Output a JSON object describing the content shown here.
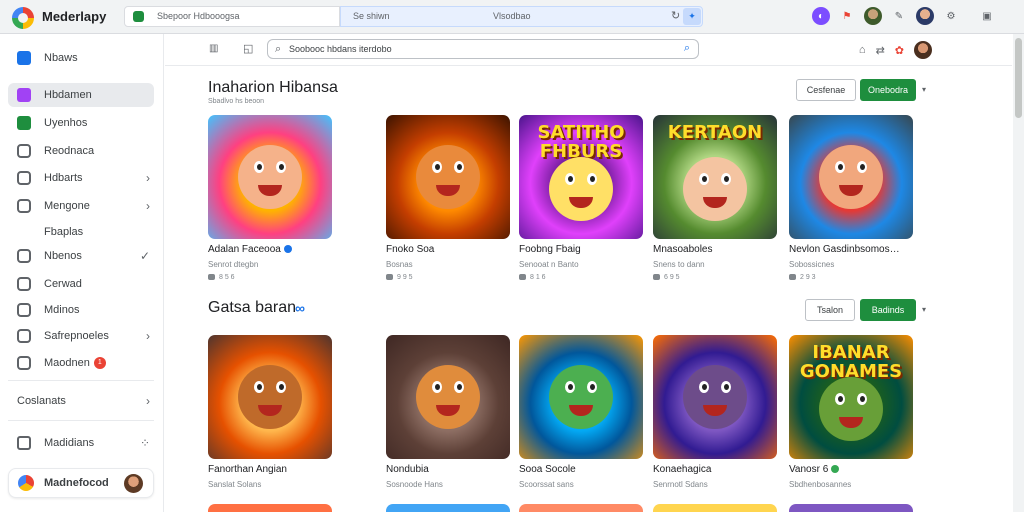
{
  "browser": {
    "brand": "Mederlapy",
    "address_text": "Sbepoor Hdbooogsa",
    "tab_text_left": "Se shiwn",
    "tab_text_right": "Vlsodbao"
  },
  "sidebar": {
    "items": [
      {
        "label": "Nbaws",
        "icon": "home-icon",
        "color": "#1a73e8",
        "active": false,
        "chevron": false
      },
      {
        "label": "Hbdamen",
        "icon": "grid-icon",
        "color": "#a142f4",
        "active": true,
        "chevron": false
      },
      {
        "label": "Uyenhos",
        "icon": "apps-icon",
        "color": "#1e8e3e",
        "active": false,
        "chevron": false
      },
      {
        "label": "Reodnaca",
        "icon": "camera-icon",
        "color": "#5f6368",
        "active": false,
        "chevron": false
      },
      {
        "label": "Hdbarts",
        "icon": "list-icon",
        "color": "#5f6368",
        "active": false,
        "chevron": true
      },
      {
        "label": "Mengone",
        "icon": "play-icon",
        "color": "#5f6368",
        "active": false,
        "chevron": true
      },
      {
        "label": "Fbaplas",
        "icon": "none",
        "color": "transparent",
        "active": false,
        "chevron": false
      },
      {
        "label": "Nbenos",
        "icon": "eye-icon",
        "color": "#5f6368",
        "active": false,
        "chevron": false,
        "chevron_alt": "✓"
      },
      {
        "label": "Cerwad",
        "icon": "circle-icon",
        "color": "#5f6368",
        "active": false,
        "chevron": false
      },
      {
        "label": "Mdinos",
        "icon": "at-icon",
        "color": "#5f6368",
        "active": false,
        "chevron": false
      },
      {
        "label": "Safrepnoeles",
        "icon": "gear-icon",
        "color": "#5f6368",
        "active": false,
        "chevron": true
      },
      {
        "label": "Maodnen",
        "icon": "bell-icon",
        "color": "#5f6368",
        "active": false,
        "chevron": false,
        "badge": "1"
      }
    ],
    "group_label": "Coslanats",
    "bottom_item": "Madidians",
    "account_name": "Madnefocod"
  },
  "toolbar": {
    "left_icon": "sidebar-toggle-icon",
    "search_text": "Soobooc hbdans iterdobo"
  },
  "sections": [
    {
      "title": "Inaharion Hibansa",
      "subtitle": "Sbadlvo hs beoon",
      "outline_btn": "Cesfenae",
      "green_btn": "Onebodra",
      "cards": [
        {
          "title": "Adalan Faceooa",
          "verified": "blue",
          "sub": "Senrot dtegbn",
          "meta": "8 5 6",
          "bg": [
            "#ffb300",
            "#ff4081",
            "#40c4ff"
          ],
          "face": "#f5b28a",
          "word": ""
        },
        {
          "title": "Fnoko Soa",
          "verified": "",
          "sub": "Bosnas",
          "meta": "9 9 5",
          "bg": [
            "#ff8a00",
            "#c43e00",
            "#3b1300"
          ],
          "face": "#e98a3c",
          "word": ""
        },
        {
          "title": "Foobng Fbaig",
          "verified": "",
          "sub": "Senooat n Banto",
          "meta": "8 1 6",
          "bg": [
            "#7b1fa2",
            "#e040fb",
            "#4a148c"
          ],
          "face": "#ffe066",
          "word": "SATITHO FHBURS"
        },
        {
          "title": "Mnasoaboles",
          "verified": "",
          "sub": "Snens to dann",
          "meta": "6 9 5",
          "bg": [
            "#aed581",
            "#558b2f",
            "#263238"
          ],
          "face": "#f4c4a1",
          "word": "KERTAON"
        },
        {
          "title": "Nevlon Gasdinbsomos…",
          "verified": "",
          "sub": "Sobossicnes",
          "meta": "2 9 3",
          "bg": [
            "#e53935",
            "#1e88e5",
            "#37474f"
          ],
          "face": "#f1a77d",
          "word": ""
        }
      ]
    },
    {
      "title": "Gatsa baran",
      "subtitle": "",
      "outline_btn": "Tsalon",
      "green_btn": "Badinds",
      "cards": [
        {
          "title": "Fanorthan Angian",
          "verified": "",
          "sub": "Sanslat Solans",
          "meta": "",
          "bg": [
            "#ffb74d",
            "#e65100",
            "#4e342e"
          ],
          "face": "#bf6a2a",
          "word": ""
        },
        {
          "title": "Nondubia",
          "verified": "",
          "sub": "Sosnoode Hans",
          "meta": "",
          "bg": [
            "#8d6e63",
            "#5d4037",
            "#3e2723"
          ],
          "face": "#e08c3c",
          "word": ""
        },
        {
          "title": "Sooa Socole",
          "verified": "",
          "sub": "Scoorssat sans",
          "meta": "",
          "bg": [
            "#03a9f4",
            "#01579b",
            "#ff9800"
          ],
          "face": "#4caf50",
          "word": ""
        },
        {
          "title": "Konaehagica",
          "verified": "",
          "sub": "Senrnotl Sdans",
          "meta": "",
          "bg": [
            "#7e57c2",
            "#311b92",
            "#ff6f00"
          ],
          "face": "#6d4c8a",
          "word": ""
        },
        {
          "title": "Vanosr 6",
          "verified": "green",
          "sub": "Sbdhenbosannes",
          "meta": "",
          "bg": [
            "#1b5e20",
            "#004d40",
            "#ff8f00"
          ],
          "face": "#689f38",
          "word": "IBANAR GONAMES"
        }
      ]
    }
  ]
}
